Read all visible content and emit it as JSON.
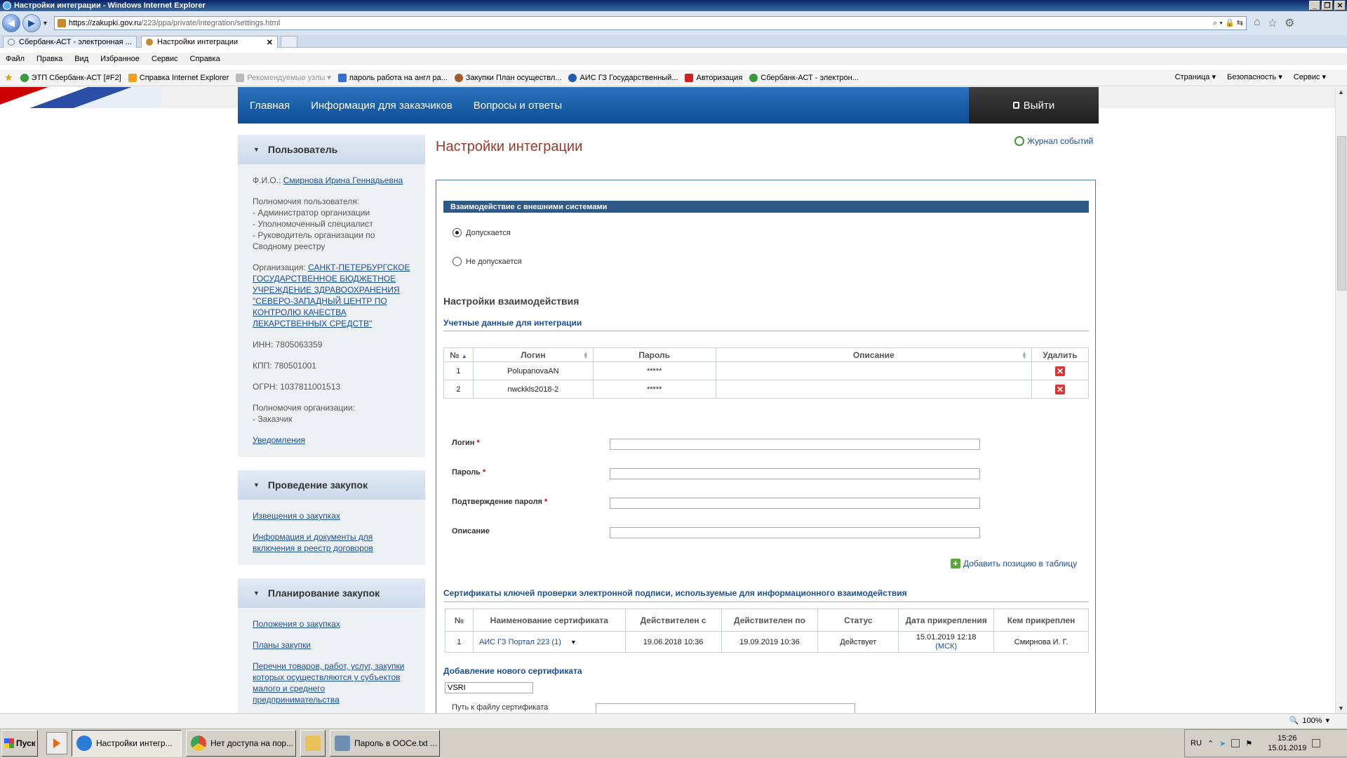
{
  "window": {
    "title": "Настройки интеграции - Windows Internet Explorer",
    "buttons": [
      "_",
      "❐",
      "✕"
    ]
  },
  "address": {
    "host": "https://zakupki.gov.ru",
    "path": "/223/ppa/private/integration/settings.html",
    "right_icons": "⌕ ▾ 🔒 ⇆"
  },
  "tabs": [
    {
      "label": "Сбербанк-АСТ - электронная ..."
    },
    {
      "label": "Настройки интеграции",
      "close": "✕"
    }
  ],
  "menu": [
    "Файл",
    "Правка",
    "Вид",
    "Избранное",
    "Сервис",
    "Справка"
  ],
  "favorites": [
    {
      "label": "ЭТП Сбербанк-АСТ [#F2]",
      "color": "#3a9a3a"
    },
    {
      "label": "Справка Internet Explorer",
      "color": "#f0a020"
    },
    {
      "label": "Рекомендуемые узлы ▾",
      "color": "#bbbbbb"
    },
    {
      "label": "пароль работа на англ ра...",
      "color": "#3a6ed0"
    },
    {
      "label": "Закупки  План осуществл...",
      "color": "#a05a2c"
    },
    {
      "label": "АИС ГЗ  Государственный...",
      "color": "#1f5ab5"
    },
    {
      "label": "Авторизация",
      "color": "#cc2222"
    },
    {
      "label": "Сбербанк-АСТ - электрон...",
      "color": "#3a9a3a"
    }
  ],
  "favbar_right": [
    "Страница ▾",
    "Безопасность ▾",
    "Сервис ▾"
  ],
  "nav": {
    "items": [
      "Главная",
      "Информация для заказчиков",
      "Вопросы и ответы"
    ],
    "logout": "Выйти"
  },
  "user": {
    "title": "Пользователь",
    "fio_label": "Ф.И.О.:",
    "fio": "Смирнова Ирина Геннадьевна",
    "permissions_label": "Полномочия пользователя:",
    "permissions": [
      "- Администратор организации",
      "- Уполномоченный специалист",
      "- Руководитель организации по Сводному реестру"
    ],
    "org_label": "Организация:",
    "org": "САНКТ-ПЕТЕРБУРГСКОЕ ГОСУДАРСТВЕННОЕ БЮДЖЕТНОЕ УЧРЕЖДЕНИЕ ЗДРАВООХРАНЕНИЯ \"СЕВЕРО-ЗАПАДНЫЙ ЦЕНТР ПО КОНТРОЛЮ КАЧЕСТВА ЛЕКАРСТВЕННЫХ СРЕДСТВ\"",
    "inn": "ИНН: 7805063359",
    "kpp": "КПП: 780501001",
    "ogrn": "ОГРН: 1037811001513",
    "org_perm_label": "Полномочия организации:",
    "org_perm": "- Заказчик",
    "notifications": "Уведомления"
  },
  "procurement": {
    "title": "Проведение закупок",
    "links": [
      "Извещения о закупках",
      "Информация и документы для включения в реестр договоров"
    ]
  },
  "planning": {
    "title": "Планирование закупок",
    "links": [
      "Положения о закупках",
      "Планы закупки",
      "Перечни товаров, работ, услуг, закупки которых осуществляются у субъектов малого и среднего предпринимательства"
    ]
  },
  "content": {
    "title": "Настройки интеграции",
    "journal": "Журнал событий",
    "section": "Взаимодействие с внешними системами",
    "radio_allowed": "Допускается",
    "radio_denied": "Не допускается",
    "settings_heading": "Настройки взаимодействия",
    "credentials_heading": "Учетные данные для интеграции",
    "cred_columns": [
      "№",
      "Логин",
      "Пароль",
      "Описание",
      "Удалить"
    ],
    "credentials": [
      {
        "num": "1",
        "login": "PolupanovaAN",
        "password": "*****",
        "description": ""
      },
      {
        "num": "2",
        "login": "nwckkls2018-2",
        "password": "*****",
        "description": ""
      }
    ],
    "form": {
      "login": "Логин",
      "password": "Пароль",
      "confirm": "Подтверждение пароля",
      "description": "Описание",
      "required": "*"
    },
    "add_position": "Добавить позицию в таблицу",
    "certs_heading": "Сертификаты ключей проверки электронной подписи, используемые для информационного взаимодействия",
    "cert_columns": [
      "№",
      "Наименование сертификата",
      "Действителен с",
      "Действителен по",
      "Статус",
      "Дата прикрепления",
      "Кем прикреплен"
    ],
    "certs": [
      {
        "num": "1",
        "name": "АИС ГЗ Портал 223 (1)",
        "from": "19.06.2018 10:36",
        "to": "19.09.2019 10:36",
        "status": "Действует",
        "attached": "15.01.2019 12:18",
        "tz": "(МСК)",
        "by": "Смирнова И. Г."
      }
    ],
    "new_cert_heading": "Добавление нового сертификата",
    "new_cert_value": "VSRI",
    "path_label": "Путь к файлу сертификата"
  },
  "statusbar": {
    "zoom": "100%"
  },
  "taskbar": {
    "start": "Пуск",
    "tasks": [
      {
        "label": "Настройки интегр...",
        "color": "#2a7ad8"
      },
      {
        "label": "Нет доступа на пор...",
        "color": "#d94a38"
      },
      {
        "label": "",
        "color": "#e8c15a"
      },
      {
        "label": "Пароль в ООСе.txt ...",
        "color": "#6f8fb3"
      }
    ],
    "lang": "RU",
    "time": "15:26",
    "date": "15.01.2019"
  }
}
